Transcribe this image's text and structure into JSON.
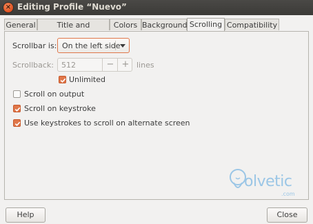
{
  "window": {
    "title": "Editing Profile “Nuevo”"
  },
  "tabs": [
    {
      "label": "General"
    },
    {
      "label": "Title and Command"
    },
    {
      "label": "Colors"
    },
    {
      "label": "Background"
    },
    {
      "label": "Scrolling",
      "active": true
    },
    {
      "label": "Compatibility"
    }
  ],
  "scrolling": {
    "scrollbar_label": "Scrollbar is:",
    "scrollbar_value": "On the left side",
    "scrollback_label": "Scrollback:",
    "scrollback_value": "512",
    "scrollback_minus": "−",
    "scrollback_plus": "+",
    "scrollback_unit": "lines",
    "unlimited_label": "Unlimited",
    "unlimited_checked": true,
    "options": [
      {
        "label": "Scroll on output",
        "checked": false
      },
      {
        "label": "Scroll on keystroke",
        "checked": true
      },
      {
        "label": "Use keystrokes to scroll on alternate screen",
        "checked": true
      }
    ]
  },
  "watermark": {
    "text": "olvetic",
    "suffix": ".com"
  },
  "buttons": {
    "help": "Help",
    "close": "Close"
  },
  "colors": {
    "accent": "#e0774a",
    "titlebar": "#3b3a37"
  }
}
